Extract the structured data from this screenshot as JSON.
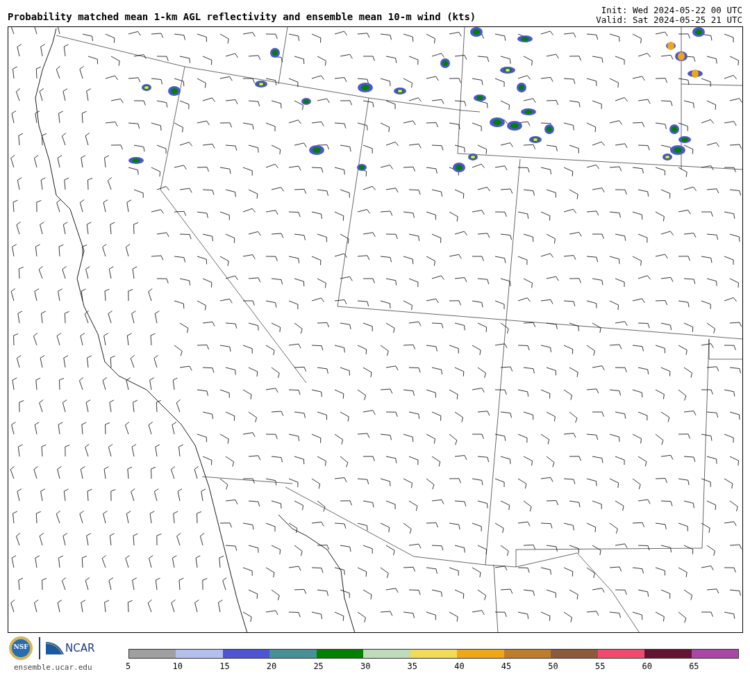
{
  "title": "Probability matched mean 1-km AGL reflectivity and ensemble mean 10-m wind (kts)",
  "init": "Init: Wed 2024-05-22 00 UTC",
  "valid": "Valid: Sat 2024-05-25 21 UTC",
  "logos": {
    "nsf": "NSF",
    "ncar": "NCAR",
    "url": "ensemble.ucar.edu"
  },
  "colorbar": {
    "segments": [
      {
        "color": "#a0a0a0"
      },
      {
        "color": "#b4bfeb"
      },
      {
        "color": "#4d55d3"
      },
      {
        "color": "#469195"
      },
      {
        "color": "#008200"
      },
      {
        "color": "#bedcb9"
      },
      {
        "color": "#f0dc5a"
      },
      {
        "color": "#f0a619"
      },
      {
        "color": "#be7d2d"
      },
      {
        "color": "#8b5a3c"
      },
      {
        "color": "#f04b6e"
      },
      {
        "color": "#641432"
      },
      {
        "color": "#aa46a5"
      }
    ],
    "ticks": [
      "5",
      "10",
      "15",
      "20",
      "25",
      "30",
      "35",
      "40",
      "45",
      "50",
      "55",
      "60",
      "65"
    ]
  }
}
